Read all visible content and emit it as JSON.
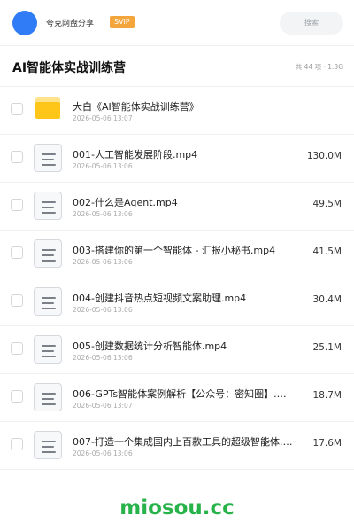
{
  "header": {
    "app_name": "夸克网盘分享",
    "badge": "SVIP",
    "search_placeholder": "搜索",
    "avatar_color": "#2f7cf6",
    "badge_color": "#f4a53b"
  },
  "page": {
    "title": "AI智能体实战训练营",
    "summary": "共 44 项 · 1.3G"
  },
  "files": [
    {
      "type": "folder",
      "name": "大白《AI智能体实战训练营》",
      "date": "2026-05-06 13:07",
      "size": ""
    },
    {
      "type": "file",
      "name": "001-人工智能发展阶段.mp4",
      "date": "2026-05-06 13:06",
      "size": "130.0M"
    },
    {
      "type": "file",
      "name": "002-什么是Agent.mp4",
      "date": "2026-05-06 13:06",
      "size": "49.5M"
    },
    {
      "type": "file",
      "name": "003-搭建你的第一个智能体 - 汇报小秘书.mp4",
      "date": "2026-05-06 13:06",
      "size": "41.5M"
    },
    {
      "type": "file",
      "name": "004-创建抖音热点短视频文案助理.mp4",
      "date": "2026-05-06 13:06",
      "size": "30.4M"
    },
    {
      "type": "file",
      "name": "005-创建数据统计分析智能体.mp4",
      "date": "2026-05-06 13:06",
      "size": "25.1M"
    },
    {
      "type": "file",
      "name": "006-GPTs智能体案例解析【公众号：密知圈】.…",
      "date": "2026-05-06 13:07",
      "size": "18.7M"
    },
    {
      "type": "file",
      "name": "007-打造一个集成国内上百款工具的超级智能体.m…",
      "date": "2026-05-06 13:06",
      "size": "17.6M"
    }
  ],
  "watermark": "miosou.cc"
}
